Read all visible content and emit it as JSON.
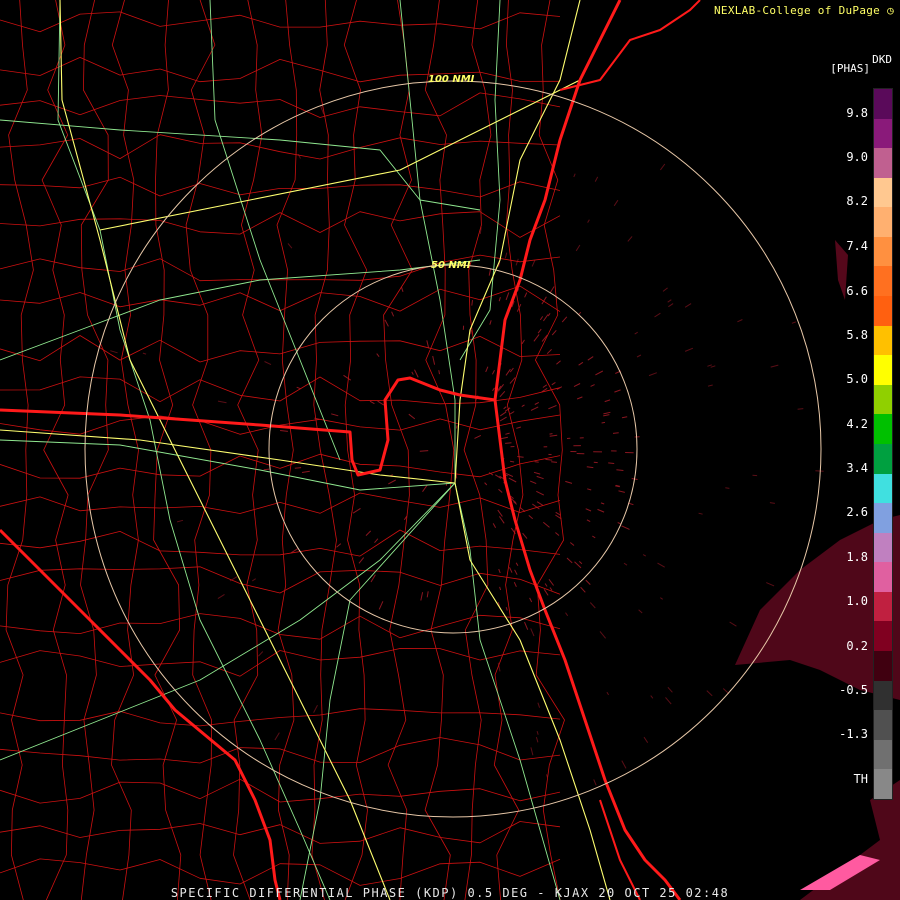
{
  "credit": "NEXLAB-College of DuPage",
  "product_code": "DKD",
  "product_unit": "[PHAS]",
  "footer": "SPECIFIC DIFFERENTIAL PHASE (KDP) 0.5 DEG - KJAX 20 OCT 25 02:48",
  "range_rings": [
    {
      "label": "50 NMI"
    },
    {
      "label": "100 NMI"
    }
  ],
  "color_scale": {
    "labels": [
      "9.8",
      "9.0",
      "8.2",
      "7.4",
      "6.6",
      "5.8",
      "5.0",
      "4.2",
      "3.4",
      "2.6",
      "1.8",
      "1.0",
      "0.2",
      "-0.5",
      "-1.3",
      "TH"
    ],
    "colors": [
      "#5a0a5a",
      "#8a1a7a",
      "#c06090",
      "#ffc890",
      "#ffb070",
      "#ff9040",
      "#ff7020",
      "#ff6010",
      "#ffc000",
      "#ffff00",
      "#90d000",
      "#00c000",
      "#00a040",
      "#40e0e0",
      "#80a0e0",
      "#c080c0",
      "#e060a0",
      "#c02040",
      "#800020",
      "#400010",
      "#303030",
      "#505050",
      "#707070",
      "#888888"
    ]
  },
  "colors": {
    "background": "#000000",
    "county_lines": "#cc1111",
    "state_lines": "#ff1a1a",
    "highways": "#90e890",
    "interstates": "#ffff70",
    "range_rings": "#e8c8a8"
  }
}
